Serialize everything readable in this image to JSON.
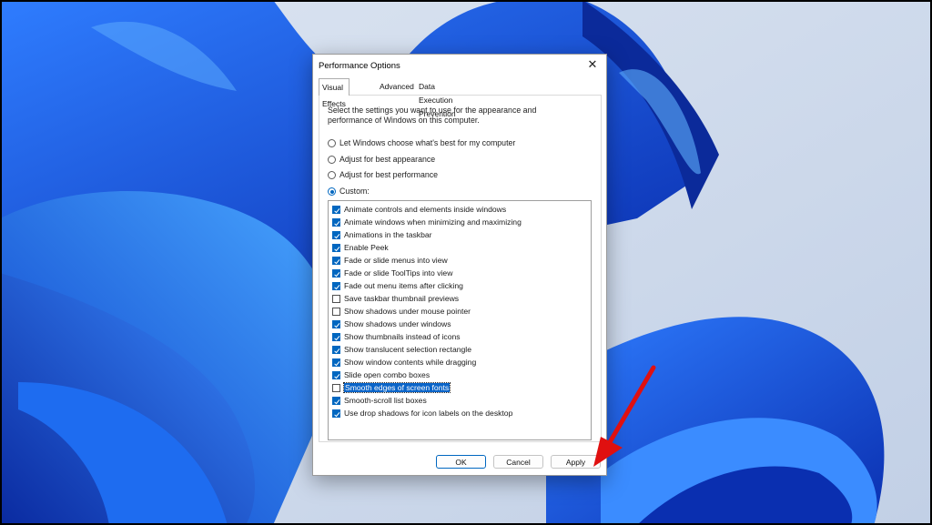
{
  "dialog": {
    "title": "Performance Options",
    "close_glyph": "✕",
    "tabs": [
      {
        "label": "Visual Effects",
        "active": true
      },
      {
        "label": "Advanced",
        "active": false
      },
      {
        "label": "Data Execution Prevention",
        "active": false
      }
    ],
    "description_line1": "Select the settings you want to use for the appearance and",
    "description_line2": "performance of Windows on this computer.",
    "radios": [
      {
        "label": "Let Windows choose what's best for my computer",
        "checked": false
      },
      {
        "label": "Adjust for best appearance",
        "checked": false
      },
      {
        "label": "Adjust for best performance",
        "checked": false
      },
      {
        "label": "Custom:",
        "checked": true
      }
    ],
    "effects": [
      {
        "label": "Animate controls and elements inside windows",
        "checked": true
      },
      {
        "label": "Animate windows when minimizing and maximizing",
        "checked": true
      },
      {
        "label": "Animations in the taskbar",
        "checked": true
      },
      {
        "label": "Enable Peek",
        "checked": true
      },
      {
        "label": "Fade or slide menus into view",
        "checked": true
      },
      {
        "label": "Fade or slide ToolTips into view",
        "checked": true
      },
      {
        "label": "Fade out menu items after clicking",
        "checked": true
      },
      {
        "label": "Save taskbar thumbnail previews",
        "checked": false
      },
      {
        "label": "Show shadows under mouse pointer",
        "checked": false
      },
      {
        "label": "Show shadows under windows",
        "checked": true
      },
      {
        "label": "Show thumbnails instead of icons",
        "checked": true
      },
      {
        "label": "Show translucent selection rectangle",
        "checked": true
      },
      {
        "label": "Show window contents while dragging",
        "checked": true
      },
      {
        "label": "Slide open combo boxes",
        "checked": true
      },
      {
        "label": "Smooth edges of screen fonts",
        "checked": false,
        "selected": true
      },
      {
        "label": "Smooth-scroll list boxes",
        "checked": true
      },
      {
        "label": "Use drop shadows for icon labels on the desktop",
        "checked": true
      }
    ],
    "buttons": {
      "ok": "OK",
      "cancel": "Cancel",
      "apply": "Apply"
    }
  },
  "colors": {
    "accent": "#0067c0",
    "arrow": "#e01010",
    "wallpaper_bg": "#c9d6e8",
    "bloom": "#1a5fe0"
  },
  "annotation": {
    "icon": "red-arrow-icon",
    "target": "apply-button"
  }
}
